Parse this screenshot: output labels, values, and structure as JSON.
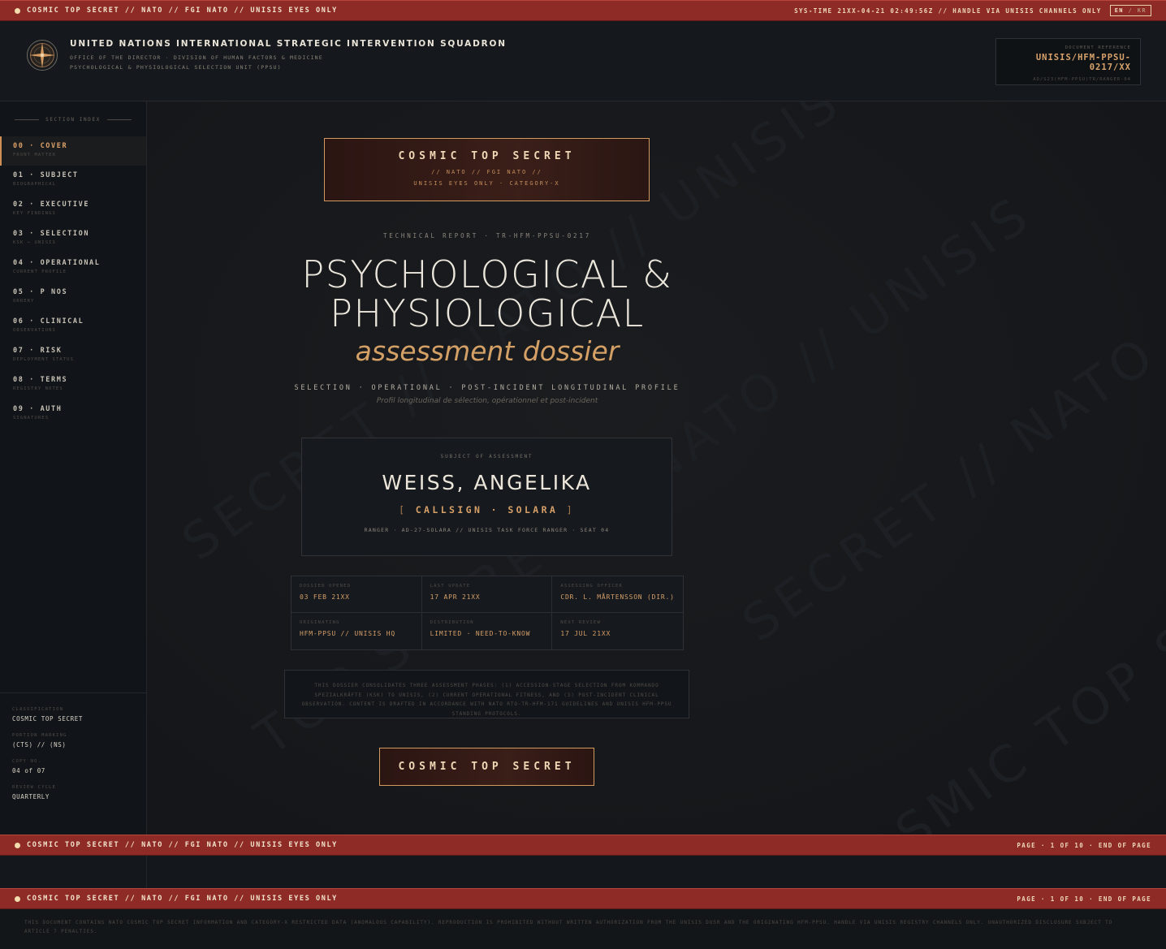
{
  "top_banner": {
    "classification": "COSMIC TOP SECRET // NATO // FGI NATO // UNISIS EYES ONLY",
    "systime": "SYS-TIME 21XX-04-21 02:49:56Z // HANDLE VIA UNISIS CHANNELS ONLY",
    "lang_active": "EN",
    "lang_sep": " / ",
    "lang_other": "KR"
  },
  "header": {
    "org_title": "UNITED NATIONS INTERNATIONAL STRATEGIC INTERVENTION SQUADRON",
    "org_sub1": "OFFICE OF THE DIRECTOR  ·  DIVISION OF HUMAN FACTORS & MEDICINE",
    "org_sub2": "PSYCHOLOGICAL & PHYSIOLOGICAL SELECTION UNIT (PPSU)",
    "ref_label": "DOCUMENT REFERENCE",
    "ref_code": "UNISIS/HFM-PPSU-0217/XX",
    "ref_sub": "AD/S23(HFM-PPSU)TR/RANGER-04"
  },
  "sidebar": {
    "section_index": "SECTION INDEX",
    "items": [
      {
        "label": "00 · COVER",
        "sub": "FRONT MATTER"
      },
      {
        "label": "01 · SUBJECT",
        "sub": "BIOGRAPHICAL"
      },
      {
        "label": "02 · EXECUTIVE",
        "sub": "KEY FINDINGS"
      },
      {
        "label": "03 · SELECTION",
        "sub": "KSK → UNISIS"
      },
      {
        "label": "04 · OPERATIONAL",
        "sub": "CURRENT PROFILE"
      },
      {
        "label": "05 · P NOS",
        "sub": "ORRERY"
      },
      {
        "label": "06 · CLINICAL",
        "sub": "OBSERVATIONS"
      },
      {
        "label": "07 · RISK",
        "sub": "DEPLOYMENT STATUS"
      },
      {
        "label": "08 · TERMS",
        "sub": "REGISTRY NOTES"
      },
      {
        "label": "09 · AUTH",
        "sub": "SIGNATURES"
      }
    ],
    "meta": [
      {
        "k": "CLASSIFICATION",
        "v": "COSMIC TOP SECRET"
      },
      {
        "k": "PORTION MARKING",
        "v": "(CTS) // (NS)"
      },
      {
        "k": "COPY NO.",
        "v": "04 of 07"
      },
      {
        "k": "REVIEW CYCLE",
        "v": "QUARTERLY"
      }
    ]
  },
  "cover": {
    "cts_title": "COSMIC TOP SECRET",
    "cts_line1": "// NATO // FGI NATO //",
    "cts_line2": "UNISIS EYES ONLY · CATEGORY-X",
    "tech_report": "TECHNICAL REPORT · TR-HFM-PPSU-0217",
    "title_line1": "PSYCHOLOGICAL &",
    "title_line2": "PHYSIOLOGICAL",
    "title_italic": "assessment dossier",
    "subline": "SELECTION · OPERATIONAL · POST-INCIDENT LONGITUDINAL PROFILE",
    "subline_fr": "Profil longitudinal de sélection, opérationnel et post-incident",
    "subject_label": "SUBJECT OF ASSESSMENT",
    "subject_name": "WEISS, ANGELIKA",
    "callsign_open": "[ ",
    "callsign_label": "CALLSIGN",
    "callsign_sep": " · ",
    "callsign_value": "SOLARA",
    "callsign_close": " ]",
    "subject_meta": "RANGER · AD-27-SOLARA // UNISIS TASK FORCE RANGER · SEAT 04",
    "grid": [
      {
        "k": "DOSSIER OPENED",
        "v": "03 FEB 21XX"
      },
      {
        "k": "LAST UPDATE",
        "v": "17 APR 21XX"
      },
      {
        "k": "ASSESSING OFFICER",
        "v": "CDR. L. MÅRTENSSON (DIR.)"
      },
      {
        "k": "ORIGINATING",
        "v": "HFM-PPSU // UNISIS HQ"
      },
      {
        "k": "DISTRIBUTION",
        "v": "LIMITED · NEED-TO-KNOW"
      },
      {
        "k": "NEXT REVIEW",
        "v": "17 JUL 21XX"
      }
    ],
    "note": "THIS DOSSIER CONSOLIDATES THREE ASSESSMENT PHASES: (1) ACCESSION-STAGE SELECTION FROM KOMMANDO SPEZIALKRÄFTE (KSK) TO UNISIS, (2) CURRENT OPERATIONAL FITNESS, AND (3) POST-INCIDENT CLINICAL OBSERVATION. CONTENT IS DRAFTED IN ACCORDANCE WITH NATO RTO-TR-HFM-171 GUIDELINES AND UNISIS HFM-PPSU STANDING PROTOCOLS.",
    "cts_button": "COSMIC TOP SECRET"
  },
  "bottom_banner": {
    "classification": "COSMIC TOP SECRET // NATO // FGI NATO // UNISIS EYES ONLY",
    "page": "PAGE · 1 OF 10 · END OF PAGE"
  },
  "legal": "THIS DOCUMENT CONTAINS NATO COSMIC TOP SECRET INFORMATION AND CATEGORY-X RESTRICTED DATA (ANOMALOUS CAPABILITY). REPRODUCTION IS PROHIBITED WITHOUT WRITTEN AUTHORIZATION FROM THE UNISIS DUSR AND THE ORIGINATING HFM-PPSU. HANDLE VIA UNISIS REGISTRY CHANNELS ONLY. UNAUTHORIZED DISCLOSURE SUBJECT TO ARTICLE 7 PENALTIES.",
  "watermark": {
    "text1": "SECRET // NATO // UNISIS",
    "text2": "TOP SECRET // NATO // UNISIS",
    "text3": "COSMIC TOP SECRET"
  },
  "colors": {
    "banner": "#8e2b27",
    "accent": "#d4a066",
    "background": "#14171b"
  }
}
